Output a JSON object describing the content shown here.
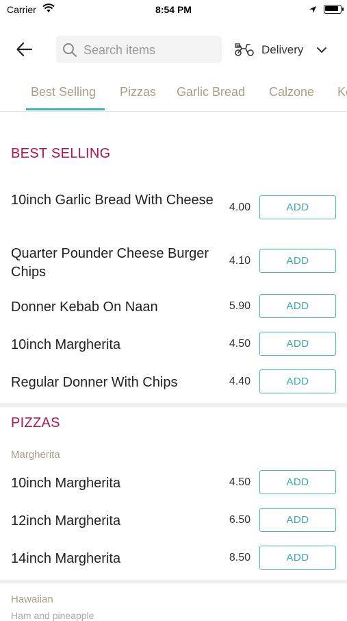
{
  "status_bar": {
    "carrier": "Carrier",
    "time": "8:54 PM"
  },
  "header": {
    "search_placeholder": "Search items",
    "delivery_label": "Delivery"
  },
  "tabs": [
    "Best Selling",
    "Pizzas",
    "Garlic Bread",
    "Calzone",
    "Ke"
  ],
  "active_tab": "Best Selling",
  "colors": {
    "accent": "#3bb4b4",
    "section_title": "#b3174a",
    "tab_text": "#a89f85"
  },
  "sections": [
    {
      "title": "BEST SELLING",
      "items": [
        {
          "name": "10inch Garlic Bread With Cheese",
          "price": "4.00",
          "button": "ADD"
        },
        {
          "name": "Quarter Pounder Cheese Burger Chips",
          "price": "4.10",
          "button": "ADD"
        },
        {
          "name": "Donner Kebab On Naan",
          "price": "5.90",
          "button": "ADD"
        },
        {
          "name": "10inch Margherita",
          "price": "4.50",
          "button": "ADD"
        },
        {
          "name": "Regular Donner With Chips",
          "price": "4.40",
          "button": "ADD"
        }
      ]
    },
    {
      "title": "PIZZAS",
      "subcategories": [
        {
          "name": "Margherita",
          "items": [
            {
              "name": "10inch Margherita",
              "price": "4.50",
              "button": "ADD"
            },
            {
              "name": "12inch Margherita",
              "price": "6.50",
              "button": "ADD"
            },
            {
              "name": "14inch Margherita",
              "price": "8.50",
              "button": "ADD"
            }
          ]
        },
        {
          "name": "Hawaiian",
          "description": "Ham and pineapple"
        }
      ]
    }
  ]
}
